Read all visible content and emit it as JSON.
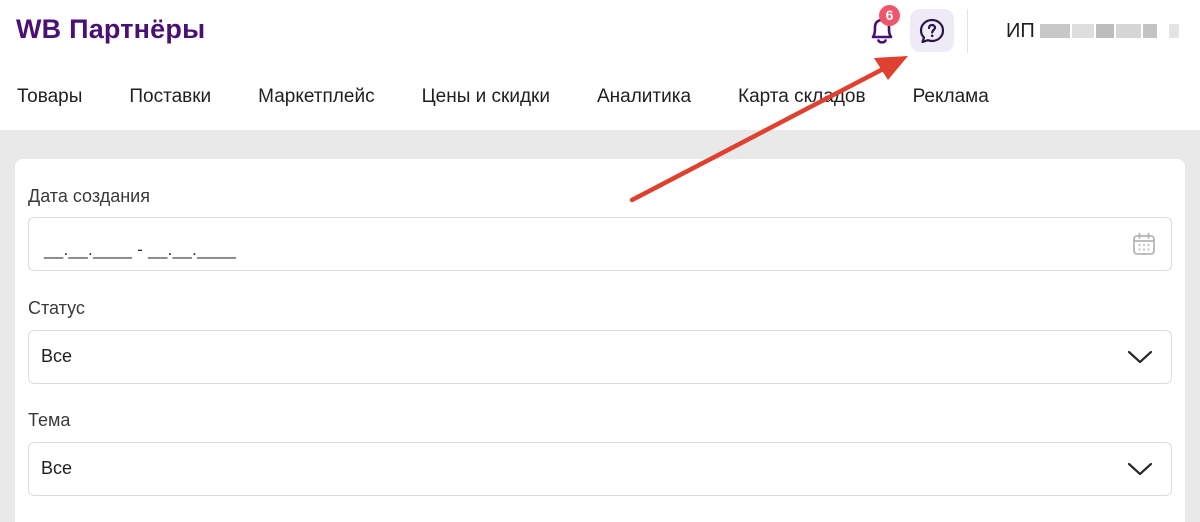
{
  "header": {
    "logo": "WB Партнёры",
    "notifications_count": "6",
    "user_prefix": "ИП"
  },
  "nav": {
    "items": [
      {
        "label": "Товары"
      },
      {
        "label": "Поставки"
      },
      {
        "label": "Маркетплейс"
      },
      {
        "label": "Цены и скидки"
      },
      {
        "label": "Аналитика"
      },
      {
        "label": "Карта складов"
      },
      {
        "label": "Реклама"
      }
    ]
  },
  "form": {
    "date": {
      "label": "Дата создания",
      "value": "__.__.____ - __.__.____"
    },
    "status": {
      "label": "Статус",
      "value": "Все"
    },
    "topic": {
      "label": "Тема",
      "value": "Все"
    }
  },
  "colors": {
    "brand": "#481173",
    "badge": "#f0566b",
    "annotation_arrow": "#e0402f"
  },
  "icons": {
    "notifications": "bell-icon",
    "help": "help-question-icon",
    "calendar": "calendar-icon",
    "dropdown": "chevron-down-icon"
  }
}
